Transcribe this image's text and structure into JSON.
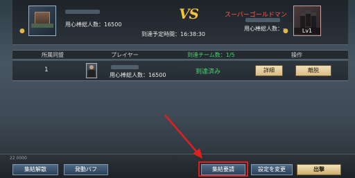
{
  "header": {
    "left": {
      "bodyguards": "用心棒総人数：16500"
    },
    "vs": "VS",
    "arrival_time": "到達予定時間：16:38:30",
    "right": {
      "name": "スーパーゴールドマン",
      "bodyguards": "用心棒総人数：--",
      "level": "Lv1"
    }
  },
  "columns": {
    "alliance": "所属同盟",
    "player": "プレイヤー",
    "team": "到達チーム数：1/5",
    "action": "操作"
  },
  "row": {
    "index": "1",
    "bodyguards": "用心棒総人数：16500",
    "status": "到達済み",
    "details_button": "詳細",
    "leave_button": "離脱"
  },
  "footer": {
    "small_label": "22 0000",
    "disband_button": "集結解散",
    "buff_button": "発動バフ",
    "request_button": "集結要請",
    "settings_button": "設定を変更",
    "attack_button": "出撃"
  },
  "colors": {
    "enemy_name": "#ff5c4a",
    "arrived_status": "#49d66f",
    "highlight": "#e21f1f",
    "vs": "#f2c23a"
  }
}
